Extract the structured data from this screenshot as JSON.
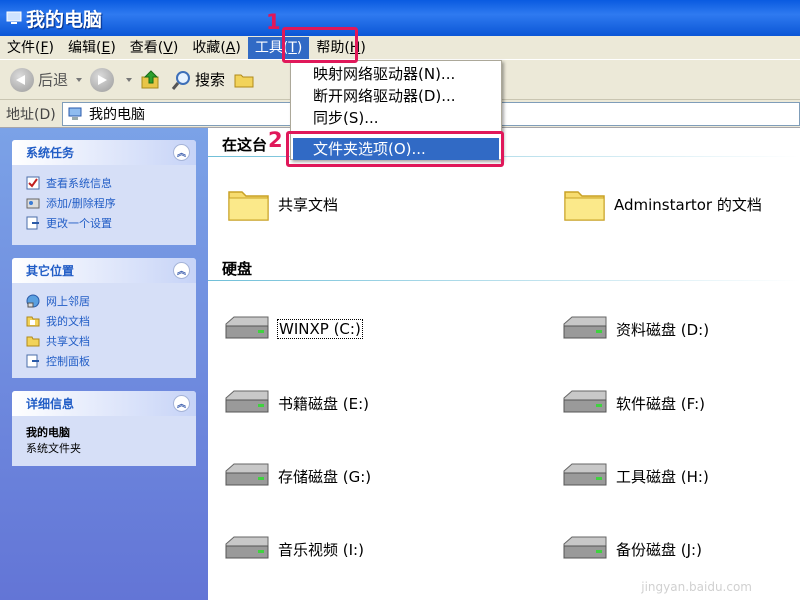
{
  "window": {
    "title": "我的电脑"
  },
  "menubar": {
    "items": [
      {
        "label": "文件",
        "key": "F"
      },
      {
        "label": "编辑",
        "key": "E"
      },
      {
        "label": "查看",
        "key": "V"
      },
      {
        "label": "收藏",
        "key": "A"
      },
      {
        "label": "工具",
        "key": "T"
      },
      {
        "label": "帮助",
        "key": "H"
      }
    ]
  },
  "toolbar": {
    "back_label": "后退",
    "search_label": "搜索"
  },
  "address": {
    "label": "地址(D)",
    "value": "我的电脑"
  },
  "tools_menu": {
    "items": [
      {
        "label": "映射网络驱动器(N)..."
      },
      {
        "label": "断开网络驱动器(D)..."
      },
      {
        "label": "同步(S)..."
      },
      {
        "label": "文件夹选项(O)..."
      }
    ]
  },
  "left_panel": {
    "system_tasks": {
      "title": "系统任务",
      "links": [
        "查看系统信息",
        "添加/删除程序",
        "更改一个设置"
      ]
    },
    "other_places": {
      "title": "其它位置",
      "links": [
        "网上邻居",
        "我的文档",
        "共享文档",
        "控制面板"
      ]
    },
    "details": {
      "title": "详细信息",
      "name": "我的电脑",
      "desc": "系统文件夹"
    }
  },
  "content": {
    "section1_title": "在这台",
    "folders": [
      "共享文档",
      "Adminstartor 的文档"
    ],
    "section2_title": "硬盘",
    "drives": [
      "WINXP (C:)",
      "资料磁盘 (D:)",
      "书籍磁盘 (E:)",
      "软件磁盘 (F:)",
      "存储磁盘 (G:)",
      "工具磁盘 (H:)",
      "音乐视频 (I:)",
      "备份磁盘 (J:)"
    ]
  },
  "annotations": {
    "step1": "1",
    "step2": "2"
  },
  "watermark": "jingyan.baidu.com",
  "colors": {
    "accent": "#e0185a",
    "selection": "#316ac5",
    "titlebar": "#0a5be0"
  }
}
